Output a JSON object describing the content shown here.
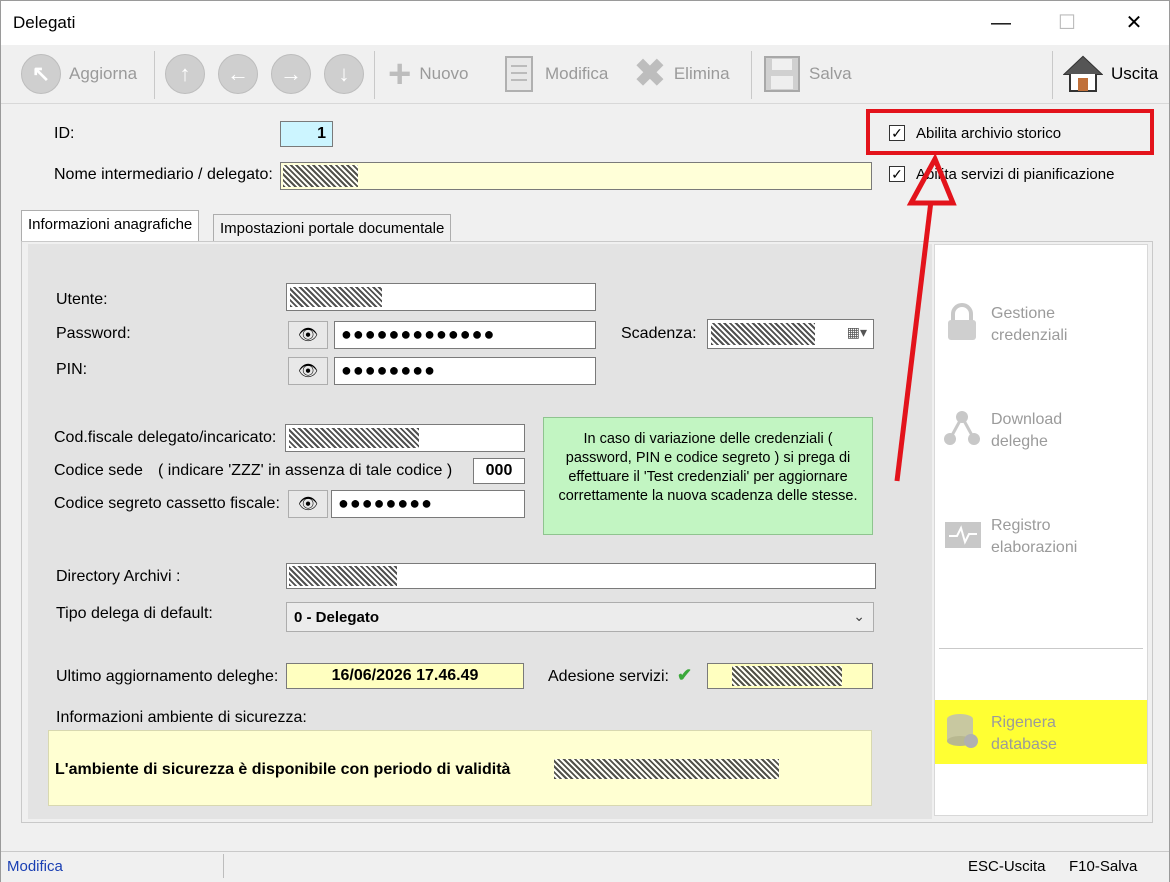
{
  "window": {
    "title": "Delegati",
    "min": "—",
    "max": "☐",
    "close": "✕"
  },
  "toolbar": {
    "refresh_label": "Aggiorna",
    "new_label": "Nuovo",
    "edit_label": "Modifica",
    "delete_label": "Elimina",
    "save_label": "Salva",
    "exit_label": "Uscita"
  },
  "header": {
    "id_label": "ID:",
    "id_value": "1",
    "name_label": "Nome intermediario / delegato:",
    "check_archive": "Abilita archivio storico",
    "check_planning": "Abilita servizi di pianificazione"
  },
  "tabs": [
    "Informazioni anagrafiche",
    "Impostazioni portale documentale"
  ],
  "form": {
    "user_label": "Utente:",
    "password_label": "Password:",
    "password_value": "●●●●●●●●●●●●●",
    "pin_label": "PIN:",
    "pin_value": "●●●●●●●●",
    "expiry_label": "Scadenza:",
    "taxcode_label": "Cod.fiscale delegato/incaricato:",
    "office_label": "Codice sede",
    "office_hint": "( indicare 'ZZZ' in assenza di tale codice )",
    "office_value": "000",
    "secret_label": "Codice segreto cassetto fiscale:",
    "secret_value": "●●●●●●●●",
    "info_note": "In caso di variazione delle credenziali ( password, PIN e codice segreto ) si prega di effettuare il 'Test credenziali' per aggiornare correttamente la nuova scadenza delle stesse.",
    "dir_label": "Directory Archivi :",
    "delega_label": "Tipo delega di default:",
    "delega_value": "0 - Delegato",
    "last_update_label": "Ultimo aggiornamento deleghe:",
    "last_update_value": "16/06/2026  17.46.49",
    "adesione_label": "Adesione servizi:",
    "security_label": "Informazioni ambiente di sicurezza:",
    "security_text": "L'ambiente di sicurezza è disponibile con periodo di validità"
  },
  "side": {
    "credentials": [
      "Gestione",
      "credenziali"
    ],
    "download": [
      "Download",
      "deleghe"
    ],
    "log": [
      "Registro",
      "elaborazioni"
    ],
    "rebuild": [
      "Rigenera",
      "database"
    ]
  },
  "status": {
    "mode": "Modifica",
    "esc": "ESC-Uscita",
    "f10": "F10-Salva"
  },
  "colors": {
    "highlight_red": "#e3131b",
    "rebuild_bg": "#ffff33",
    "note_bg": "#c2f5c2",
    "field_yellow": "#ffffd8"
  }
}
